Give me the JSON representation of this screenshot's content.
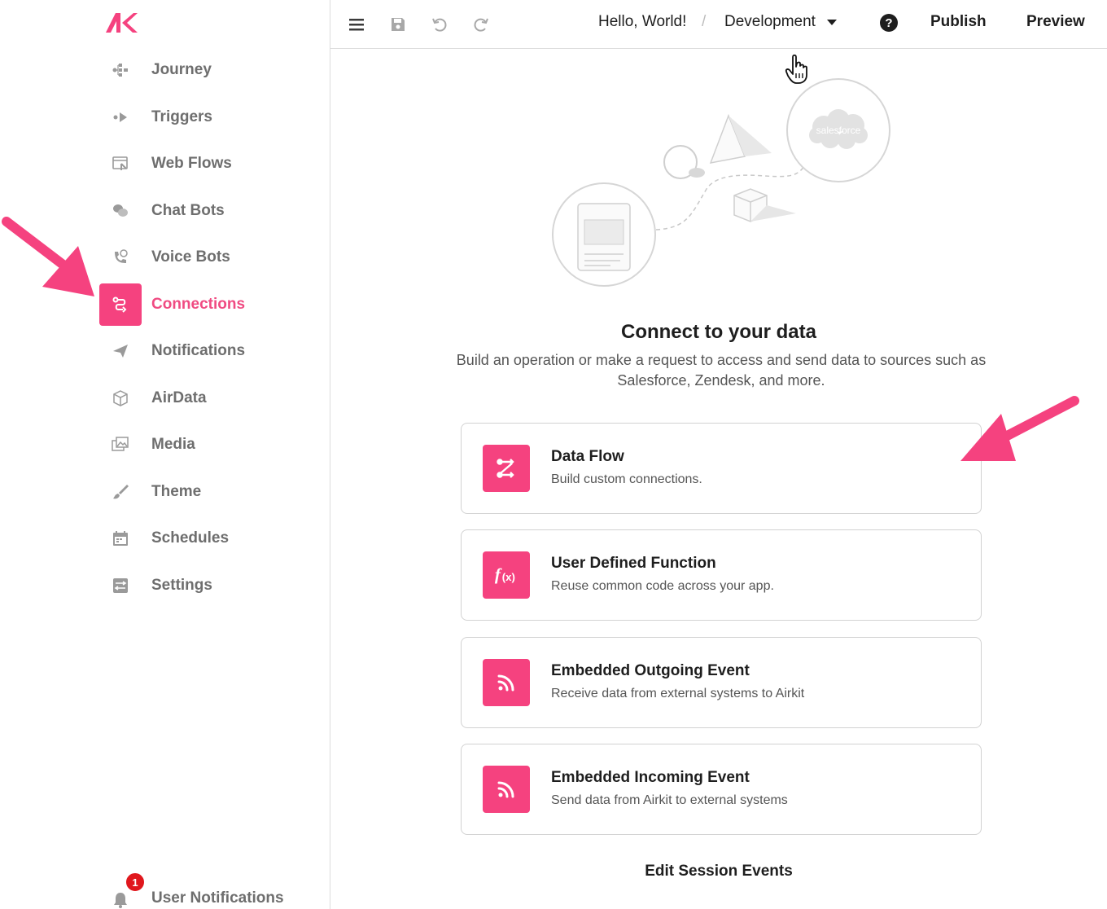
{
  "brand": {
    "logo_text": "AK",
    "accent": "#f5427f"
  },
  "sidebar": {
    "items": [
      {
        "label": "Journey",
        "icon": "journey-icon"
      },
      {
        "label": "Triggers",
        "icon": "triggers-icon"
      },
      {
        "label": "Web Flows",
        "icon": "web-flows-icon"
      },
      {
        "label": "Chat Bots",
        "icon": "chat-bots-icon"
      },
      {
        "label": "Voice Bots",
        "icon": "voice-bots-icon"
      },
      {
        "label": "Connections",
        "icon": "connections-icon",
        "active": true
      },
      {
        "label": "Notifications",
        "icon": "notifications-icon"
      },
      {
        "label": "AirData",
        "icon": "airdata-icon"
      },
      {
        "label": "Media",
        "icon": "media-icon"
      },
      {
        "label": "Theme",
        "icon": "theme-icon"
      },
      {
        "label": "Schedules",
        "icon": "schedules-icon"
      },
      {
        "label": "Settings",
        "icon": "settings-icon"
      }
    ],
    "user_notifications": {
      "label": "User Notifications",
      "count": "1"
    }
  },
  "header": {
    "app_name": "Hello, World!",
    "separator": "/",
    "environment": "Development",
    "help": "?",
    "publish": "Publish",
    "preview": "Preview"
  },
  "illustration": {
    "brand_label": "salesforce"
  },
  "main": {
    "title": "Connect to your data",
    "description": "Build an operation or make a request to access and send data to sources such as Salesforce, Zendesk, and more.",
    "cards": [
      {
        "title": "Data Flow",
        "desc": "Build custom connections.",
        "icon": "data-flow-icon"
      },
      {
        "title": "User Defined Function",
        "desc": "Reuse common code across your app.",
        "icon": "function-icon"
      },
      {
        "title": "Embedded Outgoing Event",
        "desc": "Receive data from external systems to Airkit",
        "icon": "rss-icon"
      },
      {
        "title": "Embedded Incoming Event",
        "desc": "Send data from Airkit to external systems",
        "icon": "rss-icon"
      }
    ],
    "edit_session": "Edit Session Events"
  }
}
